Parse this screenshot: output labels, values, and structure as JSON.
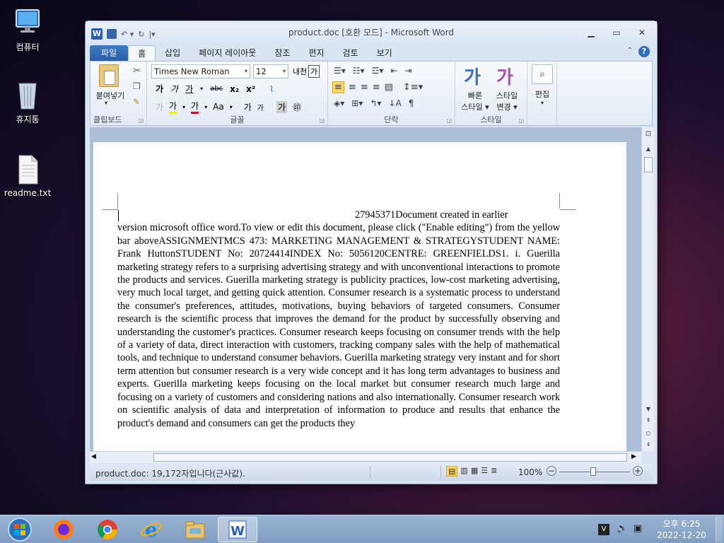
{
  "desktop": {
    "icons": [
      {
        "label": "컴퓨터",
        "icon": "computer-icon"
      },
      {
        "label": "휴지통",
        "icon": "recycle-bin-icon"
      },
      {
        "label": "readme.txt",
        "icon": "text-file-icon"
      }
    ]
  },
  "window": {
    "title": "product.doc [호환 모드]  -  Microsoft Word",
    "app_icon": "W",
    "controls": [
      "minimize-icon",
      "restore-icon",
      "close-icon"
    ]
  },
  "ribbon": {
    "tabs": [
      "파일",
      "홈",
      "삽입",
      "페이지 레이아웃",
      "참조",
      "편지",
      "검토",
      "보기"
    ],
    "active_tab": "홈",
    "clipboard": {
      "paste": "붙여넣기",
      "label": "클립보드"
    },
    "font": {
      "name": "Times New Roman",
      "size": "12",
      "label": "글꼴",
      "bold": "가",
      "italic": "가",
      "underline": "가",
      "strike": "abc",
      "sub": "x₂",
      "sup": "x²",
      "highlight": "가",
      "color": "가",
      "case": "Aa",
      "grow": "가",
      "shrink": "가",
      "clear": "가",
      "phonetic": "내천",
      "border_char": "가"
    },
    "paragraph": {
      "label": "단락"
    },
    "styles": {
      "quick": "빠른",
      "quick2": "스타일",
      "change": "스타일",
      "change2": "변경",
      "label": "스타일",
      "glyph1": "가",
      "glyph2": "가"
    },
    "editing": {
      "label": "편집"
    }
  },
  "document": {
    "first_line": "27945371Document created in earlier",
    "body": "version microsoft office word.To view or edit this document, please click (\"Enable editing\") from the yellow bar aboveASSIGNMENTMCS 473: MARKETING MANAGEMENT & STRATEGYSTUDENT NAME: Frank HuttonSTUDENT No: 20724414INDEX No: 5056120CENTRE: GREENFIELDS1. i. Guerilla marketing strategy refers to a surprising advertising strategy and with unconventional interactions to promote the products and services. Guerilla marketing strategy is publicity practices, low-cost marketing advertising, very much local target, and getting quick attention. Consumer research is a systematic process to understand the consumer's preferences, attitudes, motivations, buying behaviors of targeted consumers. Consumer research is the scientific process that improves the demand for the product by successfully observing and understanding the customer's practices. Consumer research keeps focusing on consumer trends with the help of a variety of data, direct interaction with customers, tracking company sales with the help of mathematical tools, and technique to understand consumer behaviors. Guerilla marketing strategy very instant and for short term attention but consumer research is a very wide concept and it has long term advantages to business and experts. Guerilla marketing keeps focusing on the local market but consumer research much large and focusing on a variety of customers and considering nations and also internationally. Consumer research work on scientific analysis of data and interpretation of information to produce and results that enhance the product's demand and consumers can get the products they"
  },
  "status": {
    "text": "product.doc: 19,172자입니다(근사값).",
    "zoom": "100%"
  },
  "taskbar": {
    "apps": [
      "start-orb-icon",
      "firefox-icon",
      "chrome-icon",
      "ie-icon",
      "explorer-icon",
      "word-icon"
    ],
    "clock_time": "오후 6:25",
    "clock_date": "2022-12-20"
  }
}
